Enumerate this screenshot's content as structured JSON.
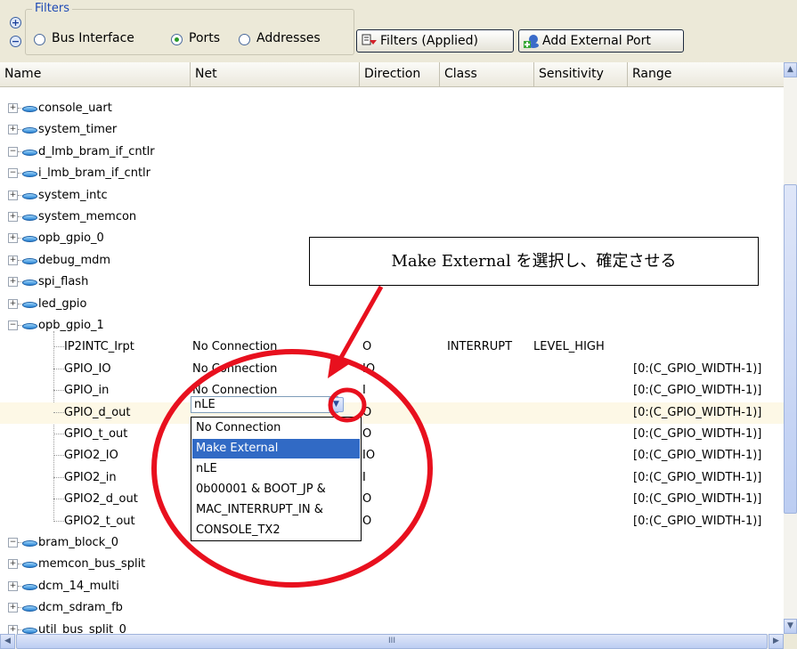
{
  "filters": {
    "legend": "Filters",
    "radios": [
      {
        "label": "Bus Interface",
        "selected": false
      },
      {
        "label": "Ports",
        "selected": true
      },
      {
        "label": "Addresses",
        "selected": false
      }
    ],
    "filters_button": "Filters (Applied)",
    "add_port_button": "Add External Port"
  },
  "columns": [
    "Name",
    "Net",
    "Direction",
    "Class",
    "Sensitivity",
    "Range"
  ],
  "tree_top": [
    {
      "name": "console_uart",
      "expanded": false
    },
    {
      "name": "system_timer",
      "expanded": false
    },
    {
      "name": "d_lmb_bram_if_cntlr",
      "expanded": true
    },
    {
      "name": "i_lmb_bram_if_cntlr",
      "expanded": true
    },
    {
      "name": "system_intc",
      "expanded": false
    },
    {
      "name": "system_memcon",
      "expanded": false
    },
    {
      "name": "opb_gpio_0",
      "expanded": false
    },
    {
      "name": "debug_mdm",
      "expanded": false
    },
    {
      "name": "spi_flash",
      "expanded": false
    },
    {
      "name": "led_gpio",
      "expanded": false
    },
    {
      "name": "opb_gpio_1",
      "expanded": true
    }
  ],
  "ports": [
    {
      "name": "IP2INTC_Irpt",
      "net": "No Connection",
      "dir": "O",
      "cls": "INTERRUPT",
      "sens": "LEVEL_HIGH",
      "range": ""
    },
    {
      "name": "GPIO_IO",
      "net": "No Connection",
      "dir": "IO",
      "cls": "",
      "sens": "",
      "range": "[0:(C_GPIO_WIDTH-1)]"
    },
    {
      "name": "GPIO_in",
      "net": "No Connection",
      "dir": "I",
      "cls": "",
      "sens": "",
      "range": "[0:(C_GPIO_WIDTH-1)]"
    },
    {
      "name": "GPIO_d_out",
      "net": "",
      "dir": "O",
      "cls": "",
      "sens": "",
      "range": "[0:(C_GPIO_WIDTH-1)]"
    },
    {
      "name": "GPIO_t_out",
      "net": "",
      "dir": "O",
      "cls": "",
      "sens": "",
      "range": "[0:(C_GPIO_WIDTH-1)]"
    },
    {
      "name": "GPIO2_IO",
      "net": "",
      "dir": "IO",
      "cls": "",
      "sens": "",
      "range": "[0:(C_GPIO_WIDTH-1)]"
    },
    {
      "name": "GPIO2_in",
      "net": "",
      "dir": "I",
      "cls": "",
      "sens": "",
      "range": "[0:(C_GPIO_WIDTH-1)]"
    },
    {
      "name": "GPIO2_d_out",
      "net": "",
      "dir": "O",
      "cls": "",
      "sens": "",
      "range": "[0:(C_GPIO_WIDTH-1)]"
    },
    {
      "name": "GPIO2_t_out",
      "net": "",
      "dir": "O",
      "cls": "",
      "sens": "",
      "range": "[0:(C_GPIO_WIDTH-1)]"
    }
  ],
  "tree_bottom": [
    {
      "name": "bram_block_0",
      "expanded": true
    },
    {
      "name": "memcon_bus_split",
      "expanded": false
    },
    {
      "name": "dcm_14_multi",
      "expanded": false
    },
    {
      "name": "dcm_sdram_fb",
      "expanded": false
    },
    {
      "name": "util_bus_split_0",
      "expanded": false
    }
  ],
  "combo": {
    "value": "nLE"
  },
  "dropdown": {
    "options": [
      "No Connection",
      "Make External",
      "nLE",
      "0b00001 & BOOT_JP &",
      "MAC_INTERRUPT_IN &",
      "CONSOLE_TX2"
    ],
    "selected_index": 1
  },
  "callout": {
    "text": "Make External を選択し、確定させる"
  },
  "scroll": {
    "h_thumb_label": "III"
  },
  "colors": {
    "highlight": "#316ac5",
    "annotation": "#e8101e",
    "selected_row": "#fdf8e6"
  }
}
